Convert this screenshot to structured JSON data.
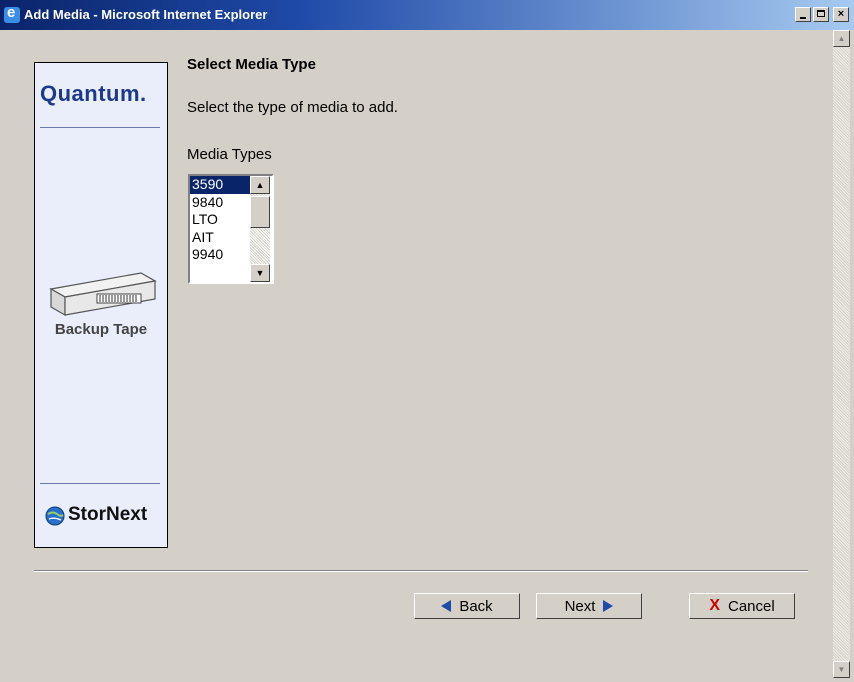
{
  "window": {
    "title": "Add Media - Microsoft Internet Explorer",
    "minimize_icon": "minimize-icon",
    "maximize_icon": "maximize-icon",
    "close_label": "×"
  },
  "sidebar": {
    "brand": "Quantum.",
    "image_label": "Backup Tape",
    "product": "StorNext"
  },
  "main": {
    "heading": "Select Media Type",
    "description": "Select the type of media to add.",
    "list_label": "Media Types",
    "media_types": [
      "3590",
      "9840",
      "LTO",
      "AIT",
      "9940"
    ],
    "selected": "3590"
  },
  "buttons": {
    "back": "Back",
    "next": "Next",
    "cancel": "Cancel",
    "cancel_icon": "X"
  },
  "colors": {
    "accent": "#0a246a",
    "arrow": "#1f4aa8",
    "cancel_x": "#d20000"
  }
}
